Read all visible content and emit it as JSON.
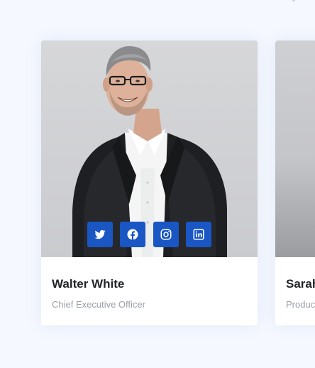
{
  "team": {
    "members": [
      {
        "name": "Walter White",
        "role": "Chief Executive Officer",
        "socials": [
          "twitter-icon",
          "facebook-icon",
          "instagram-icon",
          "linkedin-icon"
        ]
      },
      {
        "name": "Sarah",
        "role": "Produc"
      }
    ]
  },
  "colors": {
    "page_background": "#f5f8ff",
    "card_background": "#ffffff",
    "social_button": "#1a56c4",
    "name_text": "#222528",
    "role_text": "#9a9ea5"
  }
}
